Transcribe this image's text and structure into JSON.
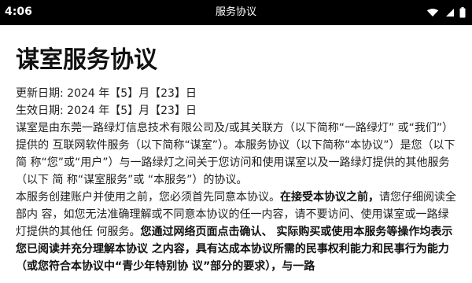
{
  "status_bar": {
    "time": "4:06",
    "title": "服务协议"
  },
  "page": {
    "heading": "谋室服务协议",
    "updated": "更新日期: 2024 年【5】月【23】日",
    "effective": "生效日期: 2024 年【5】月【23】日",
    "paragraph1": "谋室是由东莞一路绿灯信息技术有限公司及/或其关联方（以下简称“一路绿灯” 或“我们”）提供的 互联网软件服务（以下简称“谋室”）。本服务协议（以下简称“本协议”）是您（以下简 称“您”或“用户”）与一路绿灯之间关于您访问和使用谋室以及一路绿灯提供的其他服务（以下 简 称“谋室服务”或 “本服务”）的协议。",
    "paragraph2_start": "本服务创建账户并使用之前，您必须首先同意本协议。",
    "paragraph2_bold1": "在接受本协议之前，",
    "paragraph2_mid": "请您仔细阅读全部内 容，如您无法准确理解或不同意本协议的任一内容，请不要访问、使用谋室或一路绿灯提供的其他任 何服务。",
    "paragraph2_bold2": "您通过网络页面点击确认、 实际购买或使用本服务等操作均表示您已阅读并充分理解本协议 之内容，具有达成本协议所需的民事权利能力和民事行为能力（或您符合本协议中“青少年特别协 议”部分的要求），与一路"
  }
}
